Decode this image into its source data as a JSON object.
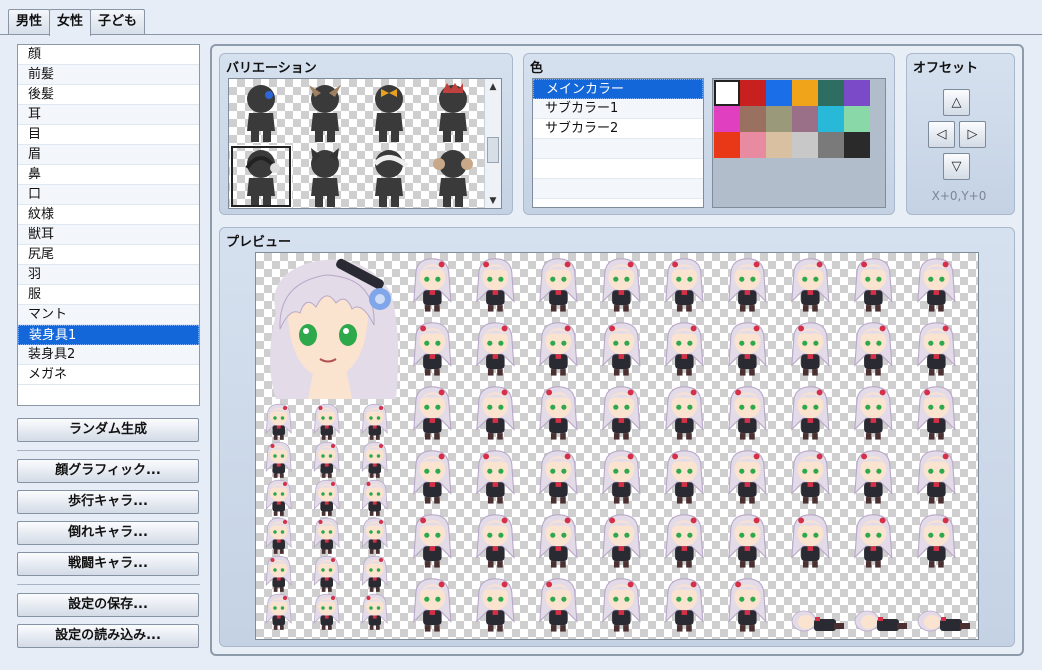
{
  "tabs": [
    "男性",
    "女性",
    "子ども"
  ],
  "active_tab": 1,
  "parts": [
    "顔",
    "前髪",
    "後髪",
    "耳",
    "目",
    "眉",
    "鼻",
    "口",
    "紋様",
    "獣耳",
    "尻尾",
    "羽",
    "服",
    "マント",
    "装身具1",
    "装身具2",
    "メガネ"
  ],
  "selected_part": 14,
  "buttons": {
    "random": "ランダム生成",
    "face_graphic": "顔グラフィック...",
    "walk_char": "歩行キャラ...",
    "fallen_char": "倒れキャラ...",
    "battle_char": "戦闘キャラ...",
    "save_settings": "設定の保存...",
    "load_settings": "設定の読み込み..."
  },
  "variation": {
    "title": "バリエーション",
    "item_icons": [
      "silhouette-plain-blue-pin-icon",
      "silhouette-rabbit-ears-icon",
      "silhouette-bow-icon",
      "silhouette-tiara-icon",
      "silhouette-headphones-icon",
      "silhouette-cat-ears-icon",
      "silhouette-maid-headband-icon",
      "silhouette-ram-horns-icon"
    ],
    "selected_index": 4
  },
  "color": {
    "title": "色",
    "items": [
      "メインカラー",
      "サブカラー1",
      "サブカラー2"
    ],
    "selected_index": 0,
    "swatches": [
      "#ffffff",
      "#c8201e",
      "#1a6ee8",
      "#f0a41a",
      "#2e6e62",
      "#7a4ac8",
      "#e040c0",
      "#9a7060",
      "#9a9a7a",
      "#9a7088",
      "#28b8d8",
      "#88d8a8",
      "#e83818",
      "#e88aa0",
      "#d8c0a0",
      "#c8c8c8",
      "#7a7a7a",
      "#2a2a2a"
    ],
    "selected_swatch": 0
  },
  "offset": {
    "title": "オフセット",
    "up": "△",
    "left": "◁",
    "right": "▷",
    "down": "▽",
    "readout": "X+0,Y+0"
  },
  "preview": {
    "title": "プレビュー"
  },
  "theme": {
    "hair": "#e3dbe8",
    "hair_shadow": "#b8a8c8",
    "skin": "#fbe4cf",
    "eye": "#2da84a",
    "outfit": "#2a2a32",
    "ribbon": "#d63048",
    "accessory": "#7fa6e8"
  }
}
